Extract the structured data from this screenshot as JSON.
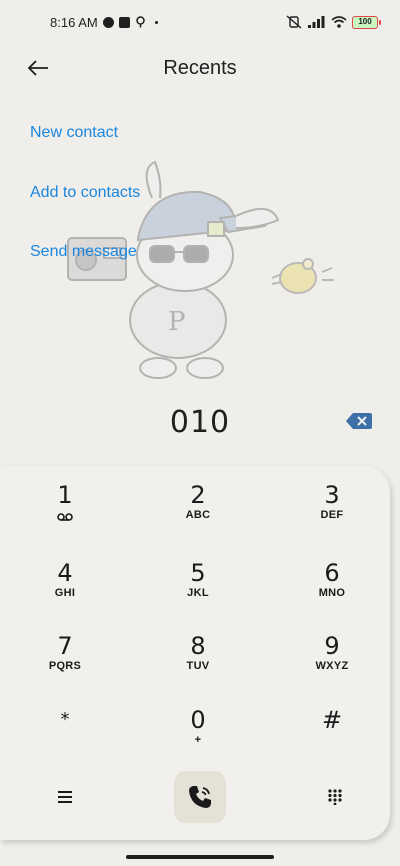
{
  "status_bar": {
    "time": "8:16 AM",
    "battery": "100"
  },
  "header": {
    "title": "Recents",
    "back_icon": "back-arrow-icon"
  },
  "actions": [
    {
      "label": "New contact"
    },
    {
      "label": "Add to contacts"
    },
    {
      "label": "Send message"
    }
  ],
  "dialer": {
    "number": "010"
  },
  "keypad": {
    "keys": [
      {
        "digit": "1",
        "letters": ""
      },
      {
        "digit": "2",
        "letters": "ABC"
      },
      {
        "digit": "3",
        "letters": "DEF"
      },
      {
        "digit": "4",
        "letters": "GHI"
      },
      {
        "digit": "5",
        "letters": "JKL"
      },
      {
        "digit": "6",
        "letters": "MNO"
      },
      {
        "digit": "7",
        "letters": "PQRS"
      },
      {
        "digit": "8",
        "letters": "TUV"
      },
      {
        "digit": "9",
        "letters": "WXYZ"
      },
      {
        "digit": "*",
        "letters": ""
      },
      {
        "digit": "0",
        "letters": "+"
      },
      {
        "digit": "#",
        "letters": ""
      }
    ]
  },
  "colors": {
    "accent": "#1a86dd",
    "background": "#efeeeb",
    "call_button": "#e4e1d7",
    "backspace": "#3e6fa6"
  }
}
